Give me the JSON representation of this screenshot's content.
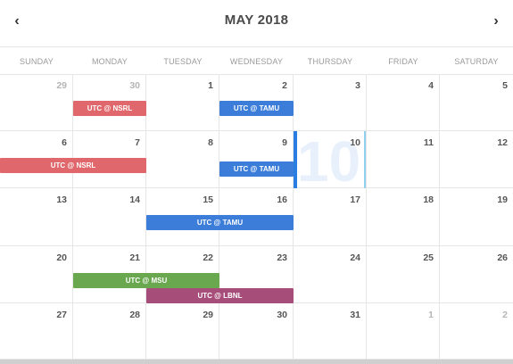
{
  "header": {
    "prev_icon": "chevron-left-icon",
    "prev_glyph": "‹",
    "title": "MAY 2018",
    "next_icon": "chevron-right-icon",
    "next_glyph": "›"
  },
  "weekdays": [
    "SUNDAY",
    "MONDAY",
    "TUESDAY",
    "WEDNESDAY",
    "THURSDAY",
    "FRIDAY",
    "SATURDAY"
  ],
  "weeks": [
    [
      {
        "d": "29",
        "other": true
      },
      {
        "d": "30",
        "other": true
      },
      {
        "d": "1"
      },
      {
        "d": "2"
      },
      {
        "d": "3"
      },
      {
        "d": "4"
      },
      {
        "d": "5"
      }
    ],
    [
      {
        "d": "6"
      },
      {
        "d": "7"
      },
      {
        "d": "8"
      },
      {
        "d": "9"
      },
      {
        "d": "10",
        "today": true
      },
      {
        "d": "11"
      },
      {
        "d": "12"
      }
    ],
    [
      {
        "d": "13"
      },
      {
        "d": "14"
      },
      {
        "d": "15"
      },
      {
        "d": "16"
      },
      {
        "d": "17"
      },
      {
        "d": "18"
      },
      {
        "d": "19"
      }
    ],
    [
      {
        "d": "20"
      },
      {
        "d": "21"
      },
      {
        "d": "22"
      },
      {
        "d": "23"
      },
      {
        "d": "24"
      },
      {
        "d": "25"
      },
      {
        "d": "26"
      }
    ],
    [
      {
        "d": "27"
      },
      {
        "d": "28"
      },
      {
        "d": "29"
      },
      {
        "d": "30"
      },
      {
        "d": "31"
      },
      {
        "d": "1",
        "other": true
      },
      {
        "d": "2",
        "other": true
      }
    ]
  ],
  "today_label": "10",
  "colors": {
    "red": "#e0676b",
    "blue": "#3b7dd8",
    "green": "#6aa84f",
    "purple": "#a64d79"
  },
  "events": [
    {
      "label": "UTC @ NSRL",
      "week": 0,
      "startCol": 1,
      "span": 1,
      "lane": 0,
      "color": "red"
    },
    {
      "label": "UTC @ TAMU",
      "week": 0,
      "startCol": 3,
      "span": 1,
      "lane": 0,
      "color": "blue"
    },
    {
      "label": "UTC @ NSRL",
      "week": 1,
      "startCol": 0,
      "span": 2,
      "lane": 0,
      "color": "red"
    },
    {
      "label": "UTC @ TAMU",
      "week": 1,
      "startCol": 3,
      "span": 1,
      "lane": 1,
      "color": "blue"
    },
    {
      "label": "UTC @ TAMU",
      "week": 2,
      "startCol": 2,
      "span": 2,
      "lane": 0,
      "color": "blue"
    },
    {
      "label": "UTC @ MSU",
      "week": 3,
      "startCol": 1,
      "span": 2,
      "lane": 0,
      "color": "green"
    },
    {
      "label": "UTC @ LBNL",
      "week": 3,
      "startCol": 2,
      "span": 2,
      "lane": 1,
      "color": "purple"
    }
  ]
}
